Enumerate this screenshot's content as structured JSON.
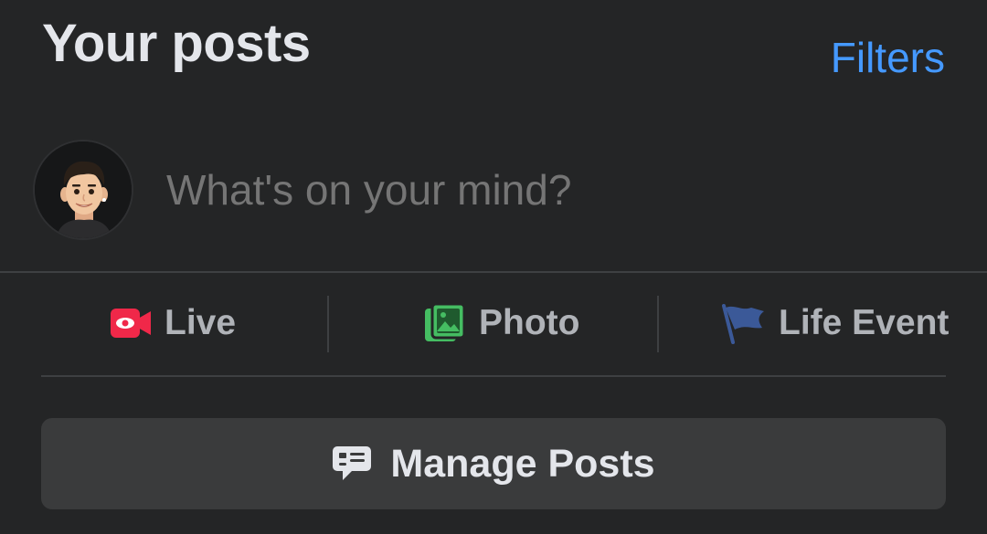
{
  "header": {
    "title": "Your posts",
    "filters_label": "Filters"
  },
  "composer": {
    "placeholder": "What's on your mind?",
    "avatar_icon": "memoji-avatar"
  },
  "actions": [
    {
      "label": "Live",
      "icon": "live-video-icon",
      "color": "#f02849"
    },
    {
      "label": "Photo",
      "icon": "photo-icon",
      "color": "#45bd62"
    },
    {
      "label": "Life Event",
      "icon": "flag-icon",
      "color": "#3b5998"
    }
  ],
  "manage": {
    "label": "Manage Posts",
    "icon": "speech-bubble-list-icon"
  },
  "colors": {
    "background": "#242526",
    "accent": "#4599ff",
    "button": "#3a3b3c"
  }
}
